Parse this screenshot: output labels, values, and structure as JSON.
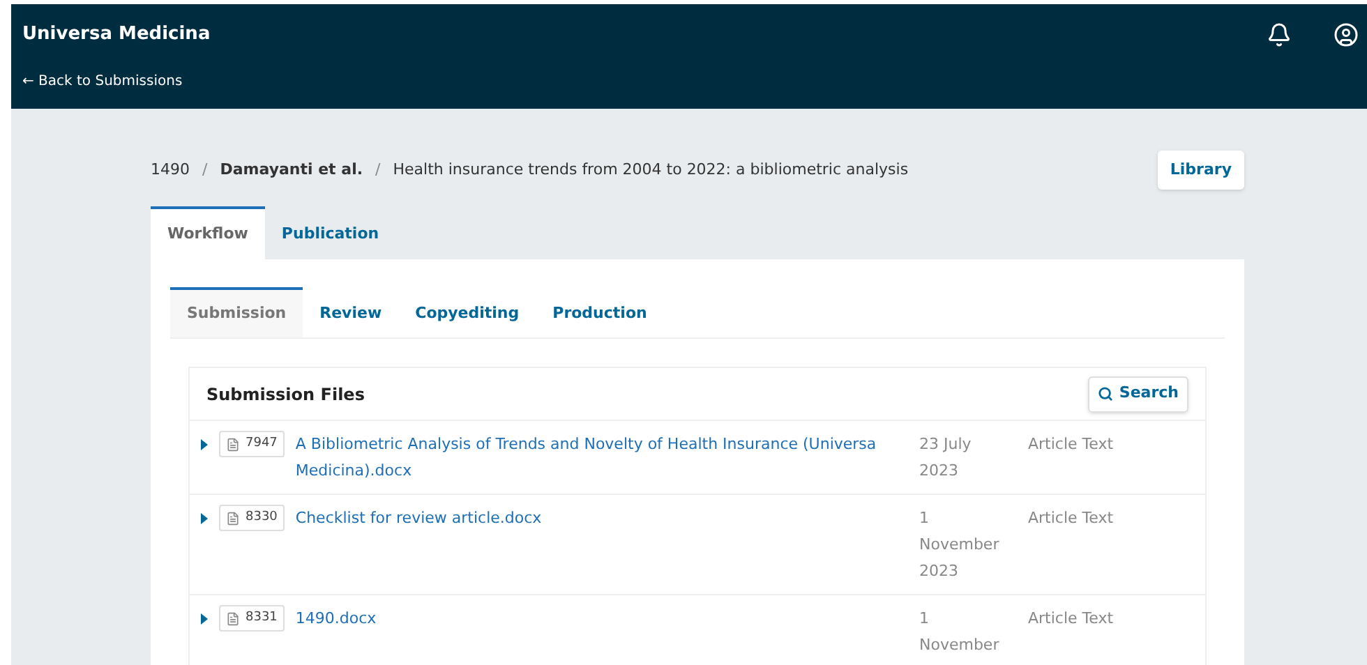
{
  "header": {
    "title": "Universa Medicina",
    "back_link": "← Back to Submissions"
  },
  "breadcrumb": {
    "id": "1490",
    "authors": "Damayanti et al.",
    "title": "Health insurance trends from 2004 to 2022: a bibliometric analysis",
    "separator": "/"
  },
  "library_button": "Library",
  "tabs": [
    {
      "label": "Workflow",
      "selected": true
    },
    {
      "label": "Publication",
      "selected": false
    }
  ],
  "stage_tabs": [
    {
      "label": "Submission",
      "selected": true
    },
    {
      "label": "Review",
      "selected": false
    },
    {
      "label": "Copyediting",
      "selected": false
    },
    {
      "label": "Production",
      "selected": false
    }
  ],
  "files_panel": {
    "title": "Submission Files",
    "search_button": "Search",
    "rows": [
      {
        "id": "7947",
        "name": "A Bibliometric Analysis of Trends and Novelty of Health Insurance (Universa Medicina).docx",
        "date": "23 July 2023",
        "type": "Article Text"
      },
      {
        "id": "8330",
        "name": "Checklist for review article.docx",
        "date": "1 November 2023",
        "type": "Article Text"
      },
      {
        "id": "8331",
        "name": "1490.docx",
        "date": "1 November",
        "type": "Article Text"
      }
    ]
  }
}
